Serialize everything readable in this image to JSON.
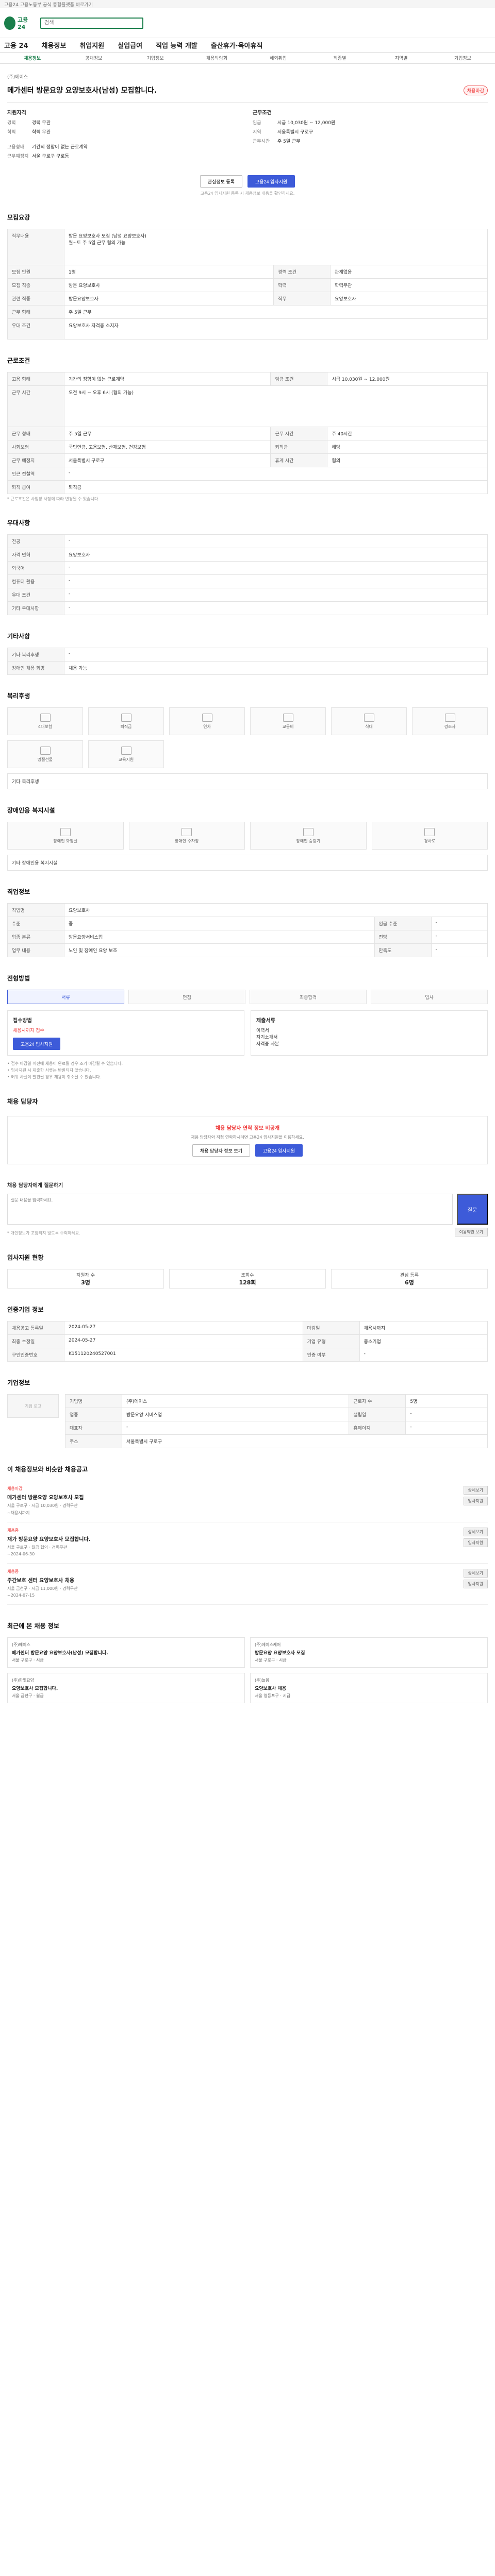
{
  "topbar": {
    "text": "고용24 고용노동부 공식 통합플랫폼 바로가기"
  },
  "header": {
    "logo": "고용24",
    "search_placeholder": "검색"
  },
  "gnb": [
    "고용 24",
    "채용정보",
    "취업지원",
    "실업급여",
    "직업 능력 개발",
    "출산휴가·육아휴직"
  ],
  "subnav": [
    "채용정보",
    "공채정보",
    "기업정보",
    "채용박람회",
    "해외취업",
    "직종별",
    "지역별",
    "기업정보"
  ],
  "job": {
    "company_label": "(주)에이스",
    "title": "메가센터 방문요양 요양보호사(남성) 모집합니다.",
    "badge": "채용마감"
  },
  "summary": {
    "left_title": "지원자격",
    "left": [
      [
        "경력",
        "경력 무관"
      ],
      [
        "학력",
        "학력 무관"
      ],
      [
        "고용형태",
        "기간의 정함이 없는 근로계약"
      ],
      [
        "근무예정지",
        "서울 구로구 구로동"
      ]
    ],
    "right_title": "근무조건",
    "right": [
      [
        "임금",
        "시급 10,030원 ~ 12,000원"
      ],
      [
        "지역",
        "서울특별시 구로구"
      ],
      [
        "근무시간",
        "주 5일 근무"
      ]
    ],
    "sub": [
      [
        "고용형태",
        "기간의 정함이 없는 근로계약"
      ],
      [
        "근무예정지",
        "서울 구로구 구로동"
      ]
    ]
  },
  "buttons": {
    "interest": "관심정보 등록",
    "apply": "고용24 입사지원"
  },
  "note": "고용24 입사지원 등록 시 채용정보 내용을 확인하세요.",
  "recruit": {
    "title": "모집요강",
    "rows": [
      [
        "직무내용",
        "방문 요양보호사 모집 (남성 요양보호사)\n월~토 주 5일 근무 협의 가능"
      ],
      [
        "모집 인원",
        "1명"
      ],
      [
        "모집 직종",
        "방문 요양보호사"
      ],
      [
        "관련 직종",
        "방문요양보호사"
      ],
      [
        "근무 형태",
        "주 5일 근무"
      ],
      [
        "우대 조건",
        "요양보호사 자격증 소지자"
      ]
    ],
    "right": [
      [
        "경력 조건",
        "관계없음"
      ],
      [
        "학력",
        "학력무관"
      ],
      [
        "직무",
        "요양보호사"
      ]
    ]
  },
  "conditions": {
    "title": "근로조건",
    "rows": [
      [
        "고용 형태",
        "기간의 정함이 없는 근로계약"
      ],
      [
        "근무 시간",
        "오전 9시 ~ 오후 6시 (협의 가능)"
      ],
      [
        "근무 형태",
        "주 5일 근무"
      ],
      [
        "사회보험",
        "국민연금, 고용보험, 산재보험, 건강보험"
      ],
      [
        "근무 예정지",
        "서울특별시 구로구"
      ],
      [
        "인근 전철역",
        "-"
      ],
      [
        "퇴직 급여",
        "퇴직금"
      ]
    ],
    "right": [
      [
        "임금 조건",
        "시급 10,030원 ~ 12,000원"
      ],
      [
        "퇴직금",
        "해당"
      ],
      [
        "근무 시간",
        "주 40시간"
      ],
      [
        "휴게 시간",
        "협의"
      ]
    ],
    "note": "* 근로조건은 사업장 사정에 따라 변경될 수 있습니다."
  },
  "qualify": {
    "title": "우대사항",
    "rows": [
      [
        "전공",
        "-"
      ],
      [
        "자격 면허",
        "요양보호사"
      ],
      [
        "외국어",
        "-"
      ],
      [
        "컴퓨터 활용",
        "-"
      ],
      [
        "우대 조건",
        "-"
      ],
      [
        "기타 우대사항",
        "-"
      ]
    ]
  },
  "etc": {
    "title": "기타사항",
    "rows": [
      [
        "기타 복리후생",
        "-"
      ],
      [
        "장애인 채용 희망",
        "채용 가능"
      ]
    ]
  },
  "welfare": {
    "title": "복리후생",
    "items": [
      "4대보험",
      "퇴직금",
      "연차",
      "교통비",
      "식대",
      "경조사",
      "명절선물",
      "교육지원"
    ],
    "more": "기타 복리후생"
  },
  "disability": {
    "title": "장애인용 복지시설",
    "items": [
      "장애인 화장실",
      "장애인 주차장",
      "장애인 승강기",
      "경사로"
    ],
    "note": "기타 장애인용 복지시설"
  },
  "company_details": {
    "title": "직업정보",
    "rows": [
      [
        "직업명",
        "요양보호사"
      ],
      [
        "수준",
        "중"
      ],
      [
        "업종 분류",
        "방문요양서비스업"
      ],
      [
        "업무 내용",
        "노인 및 장애인 요양 보조"
      ]
    ],
    "right": [
      [
        "임금 수준",
        "-"
      ],
      [
        "전망",
        "-"
      ],
      [
        "만족도",
        "-"
      ]
    ]
  },
  "process": {
    "title": "전형방법",
    "steps": [
      "서류",
      "면접",
      "최종합격",
      "입사"
    ],
    "apply_title": "접수방법",
    "apply_lines": [
      "채용시까지 접수",
      "고용24 입사지원"
    ],
    "doc_title": "제출서류",
    "doc_lines": [
      "이력서",
      "자기소개서",
      "자격증 사본"
    ],
    "bullets": [
      "• 접수 마감일 이전에 채용이 완료될 경우 조기 마감될 수 있습니다.",
      "• 입사지원 시 제출한 서류는 반환되지 않습니다.",
      "• 허위 사실이 발견될 경우 채용이 취소될 수 있습니다."
    ]
  },
  "manager": {
    "title": "채용 담당자",
    "warn_title": "채용 담당자 연락 정보 비공개",
    "warn_body": "채용 담당자와 직접 연락하시려면 고용24 입사지원을 이용하세요.",
    "btn1": "채용 담당자 정보 보기",
    "btn2": "고용24 입사지원"
  },
  "inquiry": {
    "title": "채용 담당자에게 질문하기",
    "placeholder": "질문 내용을 입력하세요.",
    "send": "질문",
    "bullets": "* 개인정보가 포함되지 않도록 주의하세요.",
    "rules_btn": "이용약관 보기"
  },
  "stats": {
    "title": "입사지원 현황",
    "items": [
      {
        "label": "지원자 수",
        "num": "3명"
      },
      {
        "label": "조회수",
        "num": "128회"
      },
      {
        "label": "관심 등록",
        "num": "6명"
      }
    ]
  },
  "job_info": {
    "title": "인증기업 정보",
    "rows": [
      [
        "채용공고 등록일",
        "2024-05-27"
      ],
      [
        "최종 수정일",
        "2024-05-27"
      ],
      [
        "구인인증번호",
        "K151120240527001"
      ]
    ],
    "right": [
      [
        "마감일",
        "채용시까지"
      ],
      [
        "기업 유형",
        "중소기업"
      ],
      [
        "인증 여부",
        "-"
      ]
    ]
  },
  "company": {
    "title": "기업정보",
    "logo_alt": "기업 로고",
    "rows": [
      [
        "기업명",
        "(주)에이스"
      ],
      [
        "업종",
        "방문요양 서비스업"
      ],
      [
        "대표자",
        "-"
      ],
      [
        "주소",
        "서울특별시 구로구"
      ]
    ],
    "right": [
      [
        "근로자 수",
        "5명"
      ],
      [
        "설립일",
        "-"
      ],
      [
        "홈페이지",
        "-"
      ]
    ]
  },
  "related": {
    "title": "이 채용정보와 비슷한 채용공고",
    "items": [
      {
        "tag": "채용마감",
        "title": "메가센터 방문요양 요양보호사 모집",
        "meta": "서울 구로구 · 시급 10,030원 · 경력무관",
        "date": "~채용시까지"
      },
      {
        "tag": "채용중",
        "title": "재가 방문요양 요양보호사 모집합니다.",
        "meta": "서울 구로구 · 월급 협의 · 경력무관",
        "date": "~2024-06-30"
      },
      {
        "tag": "채용중",
        "title": "주간보호 센터 요양보호사 채용",
        "meta": "서울 금천구 · 시급 11,000원 · 경력무관",
        "date": "~2024-07-15"
      }
    ],
    "btn_detail": "상세보기",
    "btn_apply": "입사지원"
  },
  "recent": {
    "title": "최근에 본 채용 정보",
    "items": [
      {
        "company": "(주)에이스",
        "title": "메가센터 방문요양 요양보호사(남성) 모집합니다.",
        "meta": "서울 구로구 · 시급"
      },
      {
        "company": "(주)에이스케어",
        "title": "방문요양 요양보호사 모집",
        "meta": "서울 구로구 · 시급"
      },
      {
        "company": "(주)한빛요양",
        "title": "요양보호사 모집합니다.",
        "meta": "서울 금천구 · 월급"
      },
      {
        "company": "(주)늘봄",
        "title": "요양보호사 채용",
        "meta": "서울 영등포구 · 시급"
      }
    ]
  }
}
